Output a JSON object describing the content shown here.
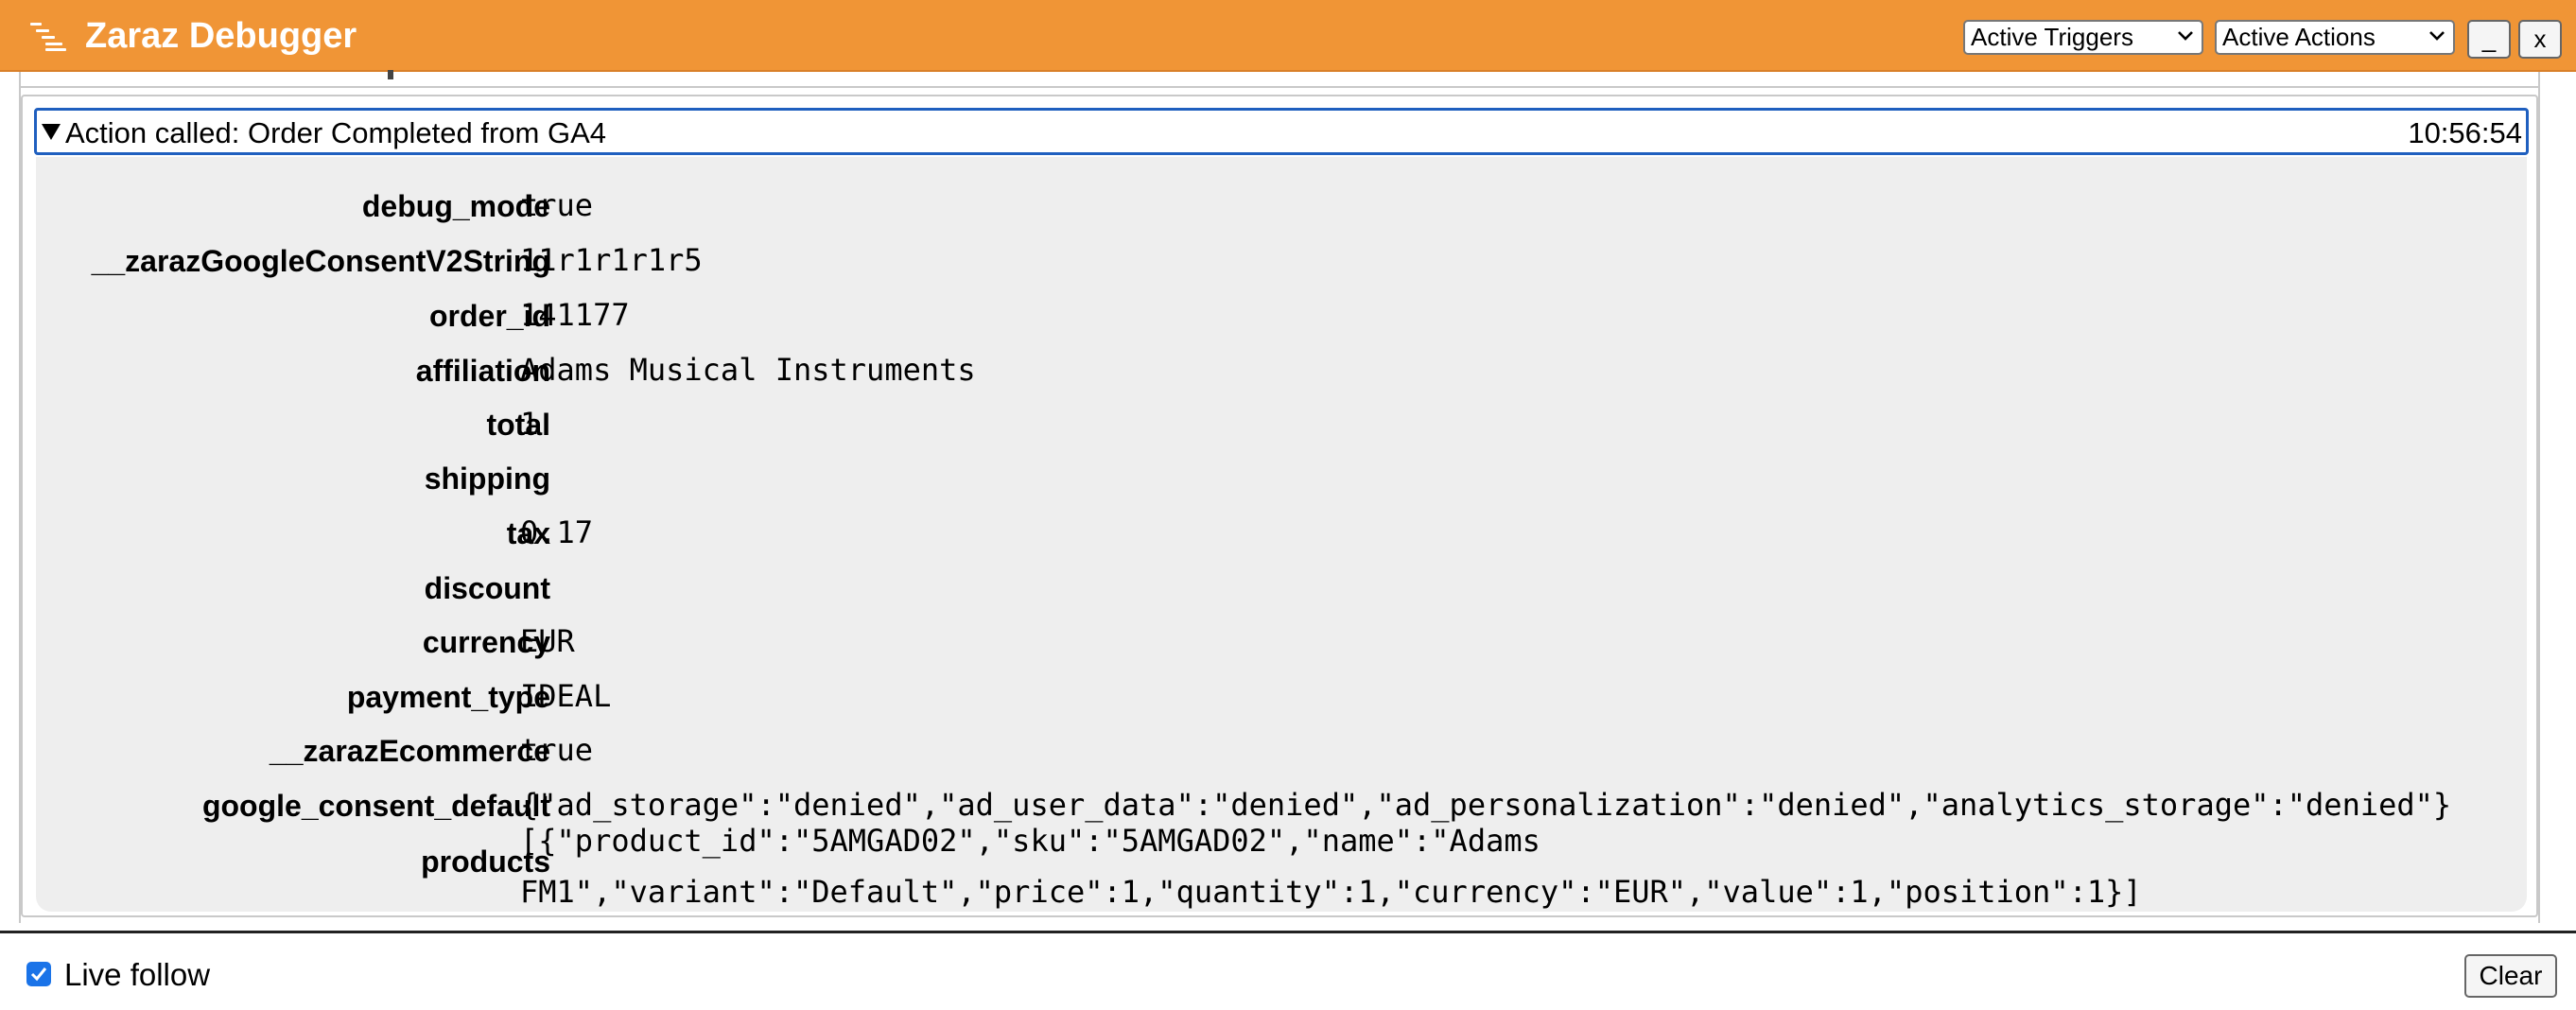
{
  "app": {
    "title": "Zaraz Debugger",
    "icon": "list-icon"
  },
  "toolbar": {
    "triggers_select": "Active Triggers",
    "actions_select": "Active Actions",
    "minimize_label": "_",
    "close_label": "x"
  },
  "entry": {
    "header": "Action called: Order Completed from GA4",
    "time": "10:56:54",
    "properties": [
      {
        "key": "debug_mode",
        "value": "true"
      },
      {
        "key": "__zarazGoogleConsentV2String",
        "value": "11r1r1r1r5"
      },
      {
        "key": "order_id",
        "value": "141177"
      },
      {
        "key": "affiliation",
        "value": "Adams Musical Instruments"
      },
      {
        "key": "total",
        "value": "1"
      },
      {
        "key": "shipping",
        "value": ""
      },
      {
        "key": "tax",
        "value": "0.17"
      },
      {
        "key": "discount",
        "value": ""
      },
      {
        "key": "currency",
        "value": "EUR"
      },
      {
        "key": "payment_type",
        "value": "IDEAL"
      },
      {
        "key": "__zarazEcommerce",
        "value": "true"
      },
      {
        "key": "google_consent_default",
        "value": "{\"ad_storage\":\"denied\",\"ad_user_data\":\"denied\",\"ad_personalization\":\"denied\",\"analytics_storage\":\"denied\"}"
      },
      {
        "key": "products",
        "value": "[{\"product_id\":\"5AMGAD02\",\"sku\":\"5AMGAD02\",\"name\":\"Adams\nFM1\",\"variant\":\"Default\",\"price\":1,\"quantity\":1,\"currency\":\"EUR\",\"value\":1,\"position\":1}]"
      }
    ]
  },
  "footer": {
    "live_follow_label": "Live follow",
    "live_follow_checked": true,
    "clear_label": "Clear"
  },
  "colors": {
    "titlebar": "#f09536",
    "accent": "#1a73e8"
  }
}
